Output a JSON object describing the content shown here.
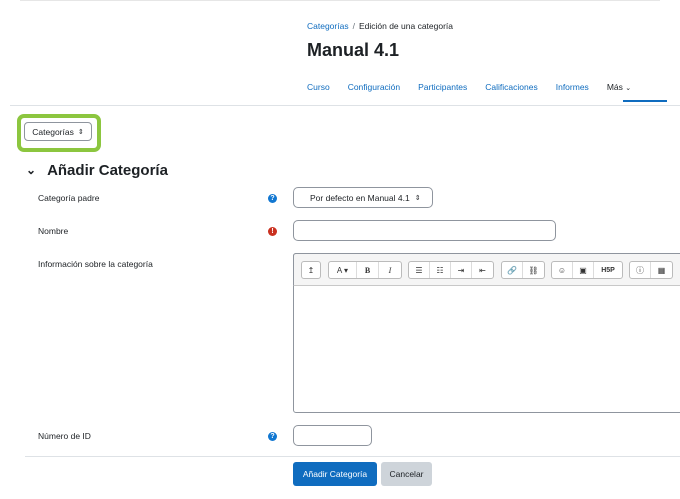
{
  "breadcrumb": {
    "link": "Categorías",
    "separator": "/",
    "current": "Edición de una categoría"
  },
  "page_title": "Manual 4.1",
  "nav": {
    "tabs": [
      "Curso",
      "Configuración",
      "Participantes",
      "Calificaciones",
      "Informes",
      "Más"
    ],
    "more_caret": "⌄"
  },
  "category_selector": {
    "label": "Categorías",
    "caret": "⇕"
  },
  "section": {
    "chevron": "⌄",
    "title": "Añadir Categoría"
  },
  "form": {
    "parent_label": "Categoría padre",
    "parent_value": "Por defecto en Manual 4.1",
    "name_label": "Nombre",
    "name_value": "",
    "info_label": "Información sobre la categoría",
    "id_label": "Número de ID",
    "id_value": ""
  },
  "editor_toolbar": {
    "g1": [
      "↥"
    ],
    "g2": [
      "A ▾",
      "B",
      "I"
    ],
    "g3": [
      "☰",
      "☷",
      "⇥",
      "⇤"
    ],
    "g4": [
      "🔗",
      "⛓"
    ],
    "g5": [
      "☺",
      "▣",
      "H5P"
    ],
    "g6": [
      "ⓘ",
      "▦"
    ]
  },
  "buttons": {
    "submit": "Añadir Categoría",
    "cancel": "Cancelar"
  },
  "colors": {
    "link": "#0f6cbf",
    "primary": "#0f6cbf",
    "highlight": "#8cc63f",
    "required": "#ca3120",
    "help": "#1177d1"
  }
}
